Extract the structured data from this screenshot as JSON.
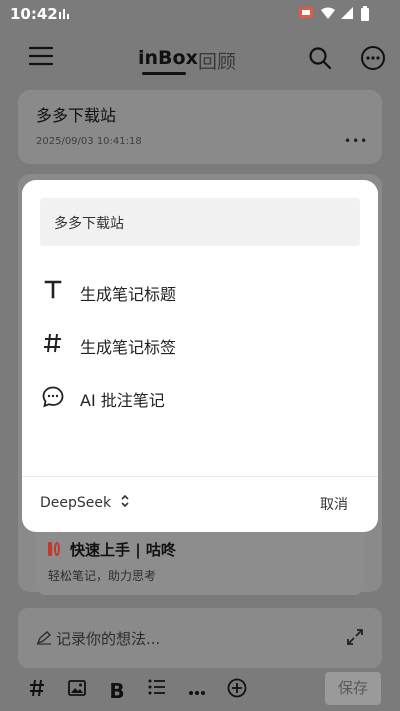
{
  "status_bar": {
    "time": "10:42",
    "icons": [
      "signal-icon",
      "cast-icon",
      "wifi-icon",
      "cell-signal-icon",
      "battery-icon"
    ]
  },
  "header": {
    "menu_icon": "hamburger-menu-icon",
    "tab_active": "inBox",
    "tab_inactive": "回顾",
    "search_icon": "search-icon",
    "more_icon": "more-circle-icon"
  },
  "notes": [
    {
      "title": "多多下载站",
      "date": "2025/09/03 10:41:18",
      "more": "•••"
    }
  ],
  "dialog": {
    "input_text": "多多下载站",
    "options": [
      {
        "icon": "T",
        "label": "生成笔记标题"
      },
      {
        "icon": "#",
        "label": "生成笔记标签"
      },
      {
        "icon": "chat-bubble-icon",
        "label": "AI 批注笔记"
      }
    ],
    "model": "DeepSeek",
    "cancel": "取消"
  },
  "quickstart_card": {
    "title": "快速上手 | 咕咚",
    "subtitle": "轻松笔记，助力思考"
  },
  "editor": {
    "placeholder": "记录你的想法...",
    "save": "保存"
  },
  "colors": {
    "overlay": "#7b7b7b",
    "dialog_bg": "#ffffff",
    "accent_red": "#c0392b"
  }
}
